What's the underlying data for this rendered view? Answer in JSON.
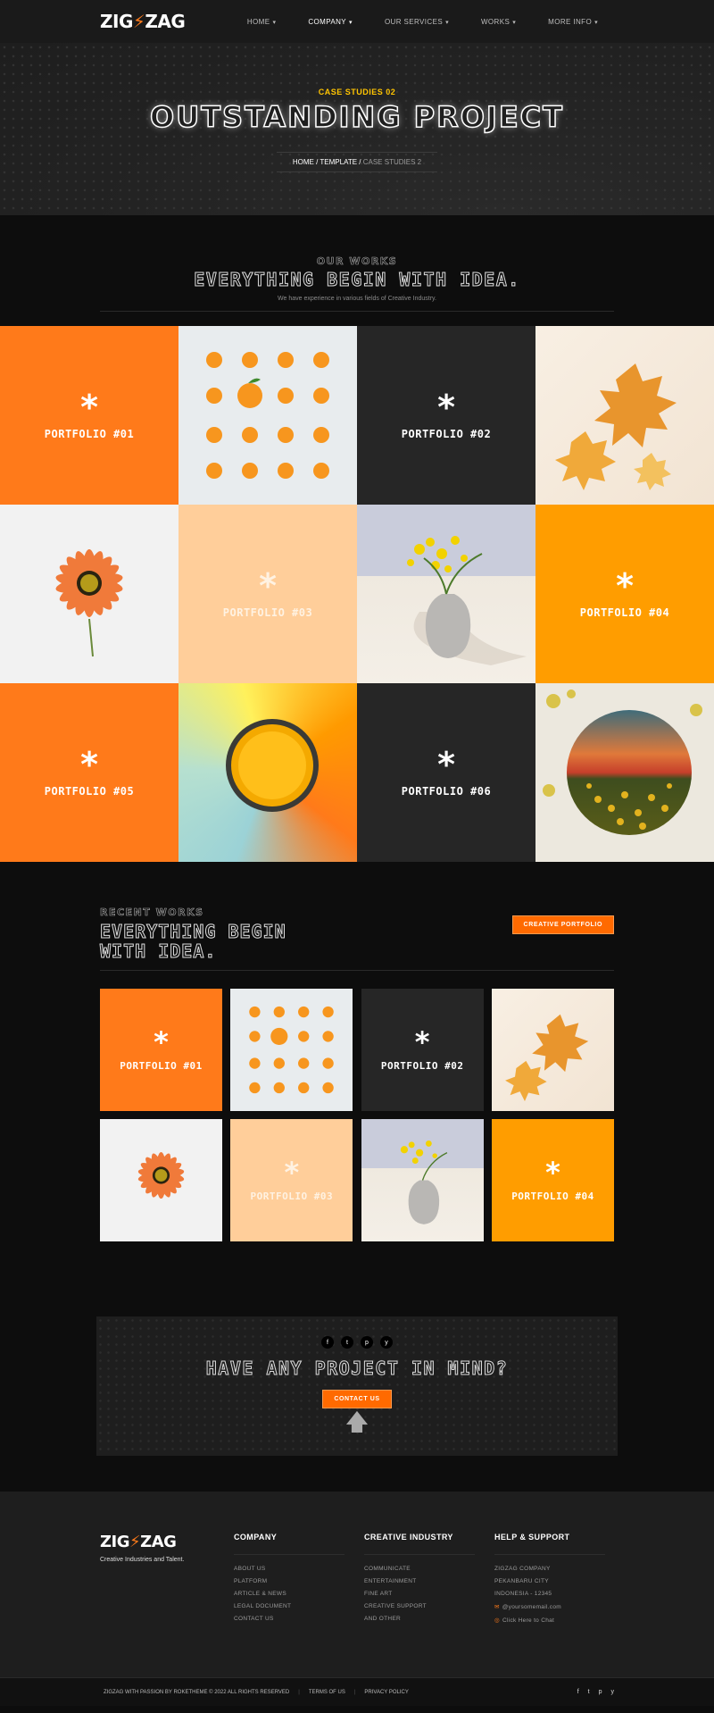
{
  "header": {
    "logo_left": "ZIG",
    "logo_bolt": "⚡",
    "logo_right": "ZAG",
    "nav": [
      {
        "label": "HOME",
        "caret": "▾"
      },
      {
        "label": "COMPANY",
        "caret": "▾"
      },
      {
        "label": "OUR SERVICES",
        "caret": "▾"
      },
      {
        "label": "WORKS",
        "caret": "▾"
      },
      {
        "label": "MORE INFO",
        "caret": "▾"
      }
    ]
  },
  "hero": {
    "kicker": "CASE STUDIES 02",
    "title": "OUTSTANDING PROJECT",
    "breadcrumb": {
      "home": "HOME",
      "sep1": " / ",
      "template": "TEMPLATE",
      "sep2": " / ",
      "current": "CASE STUDIES 2"
    }
  },
  "works": {
    "kicker": "OUR WORKS",
    "title": "EVERYTHING BEGIN WITH IDEA.",
    "subtitle": "We have experience in various fields of Creative Industry.",
    "star": "*",
    "tiles": [
      {
        "type": "card",
        "label": "PORTFOLIO #01"
      },
      {
        "type": "photo",
        "subject": "oranges"
      },
      {
        "type": "card",
        "label": "PORTFOLIO #02"
      },
      {
        "type": "photo",
        "subject": "leaves"
      },
      {
        "type": "photo",
        "subject": "flower"
      },
      {
        "type": "card",
        "label": "PORTFOLIO #03"
      },
      {
        "type": "photo",
        "subject": "vase"
      },
      {
        "type": "card",
        "label": "PORTFOLIO #04"
      },
      {
        "type": "card",
        "label": "PORTFOLIO #05"
      },
      {
        "type": "photo",
        "subject": "jar"
      },
      {
        "type": "card",
        "label": "PORTFOLIO #06"
      },
      {
        "type": "photo",
        "subject": "painting"
      }
    ]
  },
  "recent": {
    "kicker": "RECENT WORKS",
    "title": "EVERYTHING BEGIN WITH IDEA.",
    "button": "CREATIVE PORTFOLIO",
    "tiles": [
      {
        "label": "PORTFOLIO #01"
      },
      {
        "label": "PORTFOLIO #02"
      },
      {
        "label": "PORTFOLIO #03"
      },
      {
        "label": "PORTFOLIO #04"
      }
    ]
  },
  "cta": {
    "socials": [
      "f",
      "t",
      "p",
      "y"
    ],
    "title": "HAVE ANY PROJECT IN MIND?",
    "button": "CONTACT US",
    "arrow": "🡅"
  },
  "footer": {
    "logo_left": "ZIG",
    "logo_bolt": "⚡",
    "logo_right": "ZAG",
    "tagline": "Creative Industries and Talent.",
    "columns": [
      {
        "heading": "COMPANY",
        "links": [
          "ABOUT US",
          "PLATFORM",
          "ARTICLE & NEWS",
          "LEGAL DOCUMENT",
          "CONTACT US"
        ]
      },
      {
        "heading": "CREATIVE INDUSTRY",
        "links": [
          "COMMUNICATE",
          "ENTERTAINMENT",
          "FINE ART",
          "CREATIVE SUPPORT",
          "AND OTHER"
        ]
      },
      {
        "heading": "HELP & SUPPORT",
        "links": [
          "ZIGZAG COMPANY",
          "PEKANBARU CITY",
          "INDONESIA - 12345"
        ],
        "email": "@yoursomemail.com",
        "chat": "Click Here to Chat"
      }
    ],
    "copyright": "ZIGZAG WITH PASSION BY ROKETHEME © 2022 ALL RIGHTS RESERVED",
    "terms": "TERMS OF US",
    "privacy": "PRIVACY POLICY",
    "sep": "|",
    "socials": [
      "f",
      "t",
      "p",
      "y"
    ]
  },
  "colors": {
    "orange": "#ff7a1a",
    "gold": "#ff9d00",
    "peach": "#ffce9a",
    "dark": "#262626",
    "kicker": "#ffc400"
  }
}
